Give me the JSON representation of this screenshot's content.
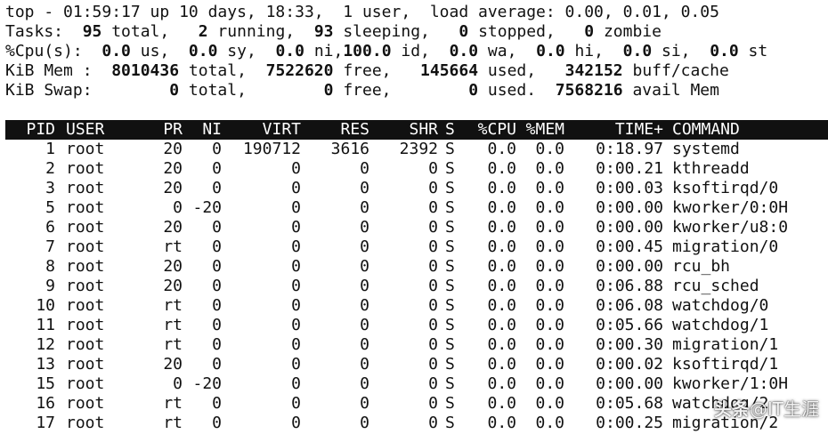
{
  "summary": {
    "line1": "top - 01:59:17 up 10 days, 18:33,  1 user,  load average: 0.00, 0.01, 0.05",
    "line2": [
      {
        "t": "Tasks: ",
        "b": false
      },
      {
        "t": " 95",
        "b": true
      },
      {
        "t": " total,   ",
        "b": false
      },
      {
        "t": "2",
        "b": true
      },
      {
        "t": " running,  ",
        "b": false
      },
      {
        "t": "93",
        "b": true
      },
      {
        "t": " sleeping,   ",
        "b": false
      },
      {
        "t": "0",
        "b": true
      },
      {
        "t": " stopped,   ",
        "b": false
      },
      {
        "t": "0",
        "b": true
      },
      {
        "t": " zombie",
        "b": false
      }
    ],
    "line3": [
      {
        "t": "%Cpu(s):  ",
        "b": false
      },
      {
        "t": "0.0",
        "b": true
      },
      {
        "t": " us,  ",
        "b": false
      },
      {
        "t": "0.0",
        "b": true
      },
      {
        "t": " sy,  ",
        "b": false
      },
      {
        "t": "0.0",
        "b": true
      },
      {
        "t": " ni,",
        "b": false
      },
      {
        "t": "100.0",
        "b": true
      },
      {
        "t": " id,  ",
        "b": false
      },
      {
        "t": "0.0",
        "b": true
      },
      {
        "t": " wa,  ",
        "b": false
      },
      {
        "t": "0.0",
        "b": true
      },
      {
        "t": " hi,  ",
        "b": false
      },
      {
        "t": "0.0",
        "b": true
      },
      {
        "t": " si,  ",
        "b": false
      },
      {
        "t": "0.0",
        "b": true
      },
      {
        "t": " st",
        "b": false
      }
    ],
    "line4": [
      {
        "t": "KiB Mem : ",
        "b": false
      },
      {
        "t": " 8010436",
        "b": true
      },
      {
        "t": " total,  ",
        "b": false
      },
      {
        "t": "7522620",
        "b": true
      },
      {
        "t": " free,   ",
        "b": false
      },
      {
        "t": "145664",
        "b": true
      },
      {
        "t": " used,   ",
        "b": false
      },
      {
        "t": "342152",
        "b": true
      },
      {
        "t": " buff/cache",
        "b": false
      }
    ],
    "line5": [
      {
        "t": "KiB Swap:        ",
        "b": false
      },
      {
        "t": "0",
        "b": true
      },
      {
        "t": " total,        ",
        "b": false
      },
      {
        "t": "0",
        "b": true
      },
      {
        "t": " free,        ",
        "b": false
      },
      {
        "t": "0",
        "b": true
      },
      {
        "t": " used.  ",
        "b": false
      },
      {
        "t": "7568216",
        "b": true
      },
      {
        "t": " avail Mem",
        "b": false
      }
    ]
  },
  "columns": [
    "PID",
    "USER",
    "PR",
    "NI",
    "VIRT",
    "RES",
    "SHR",
    "S",
    "%CPU",
    "%MEM",
    "TIME+",
    "COMMAND"
  ],
  "processes": [
    [
      "1",
      "root",
      "20",
      "0",
      "190712",
      "3616",
      "2392",
      "S",
      "0.0",
      "0.0",
      "0:18.97",
      "systemd"
    ],
    [
      "2",
      "root",
      "20",
      "0",
      "0",
      "0",
      "0",
      "S",
      "0.0",
      "0.0",
      "0:00.21",
      "kthreadd"
    ],
    [
      "3",
      "root",
      "20",
      "0",
      "0",
      "0",
      "0",
      "S",
      "0.0",
      "0.0",
      "0:00.03",
      "ksoftirqd/0"
    ],
    [
      "5",
      "root",
      "0",
      "-20",
      "0",
      "0",
      "0",
      "S",
      "0.0",
      "0.0",
      "0:00.00",
      "kworker/0:0H"
    ],
    [
      "6",
      "root",
      "20",
      "0",
      "0",
      "0",
      "0",
      "S",
      "0.0",
      "0.0",
      "0:00.00",
      "kworker/u8:0"
    ],
    [
      "7",
      "root",
      "rt",
      "0",
      "0",
      "0",
      "0",
      "S",
      "0.0",
      "0.0",
      "0:00.45",
      "migration/0"
    ],
    [
      "8",
      "root",
      "20",
      "0",
      "0",
      "0",
      "0",
      "S",
      "0.0",
      "0.0",
      "0:00.00",
      "rcu_bh"
    ],
    [
      "9",
      "root",
      "20",
      "0",
      "0",
      "0",
      "0",
      "S",
      "0.0",
      "0.0",
      "0:06.88",
      "rcu_sched"
    ],
    [
      "10",
      "root",
      "rt",
      "0",
      "0",
      "0",
      "0",
      "S",
      "0.0",
      "0.0",
      "0:06.08",
      "watchdog/0"
    ],
    [
      "11",
      "root",
      "rt",
      "0",
      "0",
      "0",
      "0",
      "S",
      "0.0",
      "0.0",
      "0:05.66",
      "watchdog/1"
    ],
    [
      "12",
      "root",
      "rt",
      "0",
      "0",
      "0",
      "0",
      "S",
      "0.0",
      "0.0",
      "0:00.30",
      "migration/1"
    ],
    [
      "13",
      "root",
      "20",
      "0",
      "0",
      "0",
      "0",
      "S",
      "0.0",
      "0.0",
      "0:00.02",
      "ksoftirqd/1"
    ],
    [
      "15",
      "root",
      "0",
      "-20",
      "0",
      "0",
      "0",
      "S",
      "0.0",
      "0.0",
      "0:00.00",
      "kworker/1:0H"
    ],
    [
      "16",
      "root",
      "rt",
      "0",
      "0",
      "0",
      "0",
      "S",
      "0.0",
      "0.0",
      "0:05.68",
      "watchdog/2"
    ],
    [
      "17",
      "root",
      "rt",
      "0",
      "0",
      "0",
      "0",
      "S",
      "0.0",
      "0.0",
      "0:00.25",
      "migration/2"
    ]
  ],
  "watermark": {
    "head": "头条",
    "handle": "@IT生涯"
  },
  "colors": {
    "background": "#ffffff",
    "text": "#111111",
    "header_bar": "#111111",
    "header_text": "#ffffff"
  }
}
